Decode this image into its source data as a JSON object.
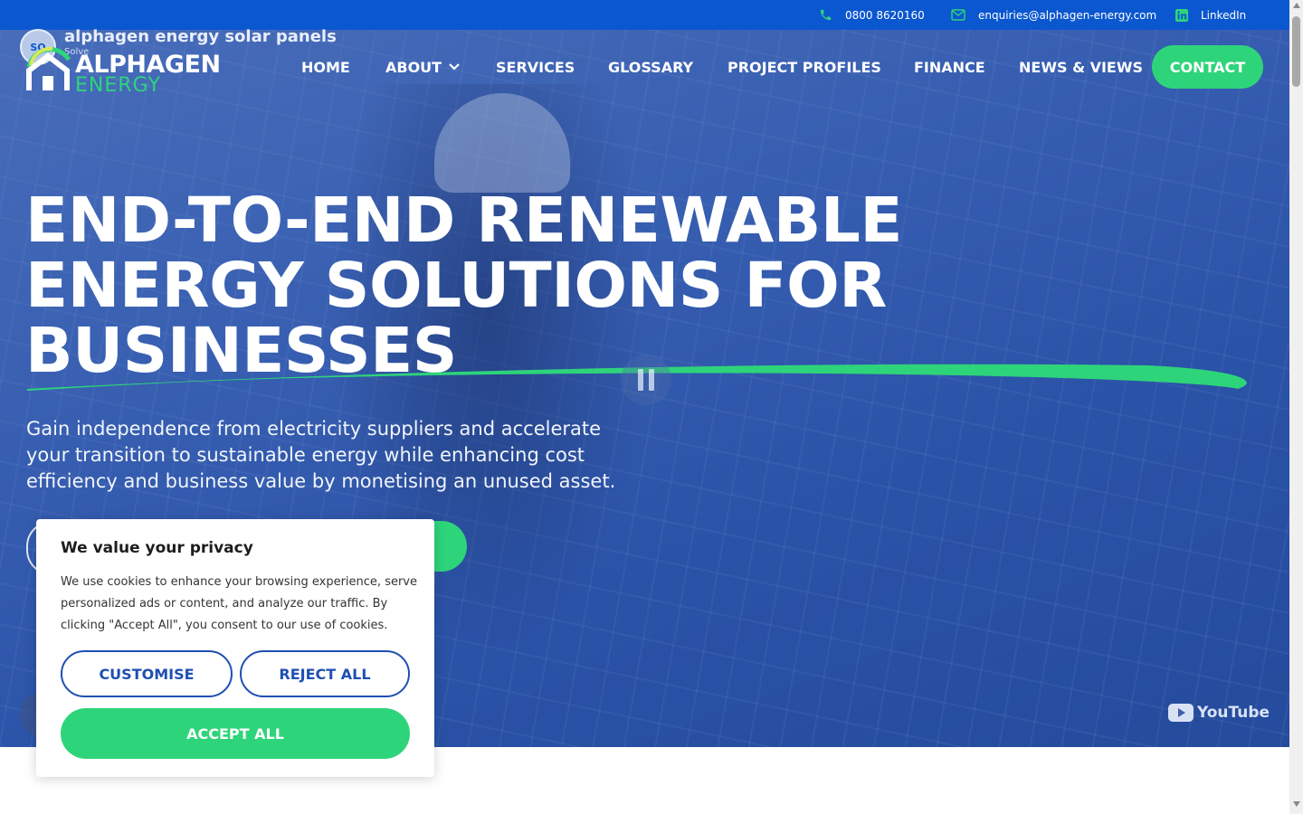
{
  "topbar": {
    "phone": "0800 8620160",
    "email": "enquiries@alphagen-energy.com",
    "linkedin": "LinkedIn",
    "background": "#0b57d0"
  },
  "video_overlay": {
    "channel_initials": "SO",
    "title": "alphagen energy solar panels",
    "channel": "Solve"
  },
  "logo": {
    "word1": "ALPHAGEN",
    "word2": "ENERGY"
  },
  "nav": {
    "items": [
      {
        "label": "HOME"
      },
      {
        "label": "ABOUT",
        "has_dropdown": true
      },
      {
        "label": "SERVICES"
      },
      {
        "label": "GLOSSARY"
      },
      {
        "label": "PROJECT PROFILES"
      },
      {
        "label": "FINANCE"
      },
      {
        "label": "NEWS & VIEWS"
      }
    ],
    "contact_label": "CONTACT"
  },
  "hero": {
    "headline_lines": [
      "END-TO-END RENEWABLE",
      "ENERGY SOLUTIONS FOR",
      "BUSINESSES"
    ],
    "subtext": "Gain independence from electricity suppliers and accelerate your transition to sustainable energy while enhancing cost efficiency and business value by monetising an unused asset.",
    "youtube_label": "YouTube"
  },
  "cookie": {
    "title": "We value your privacy",
    "body": "We use cookies to enhance your browsing experience, serve personalized ads or content, and analyze our traffic. By clicking \"Accept All\", you consent to our use of cookies.",
    "customise": "CUSTOMISE",
    "reject": "REJECT ALL",
    "accept": "ACCEPT ALL"
  },
  "colors": {
    "brand_blue": "#0b57d0",
    "accent_green": "#2ed47a",
    "button_outline_blue": "#1f4fb3"
  },
  "icons": [
    "phone-icon",
    "mail-icon",
    "linkedin-icon",
    "chevron-down-icon",
    "pause-icon",
    "youtube-icon",
    "logo-house-icon"
  ]
}
